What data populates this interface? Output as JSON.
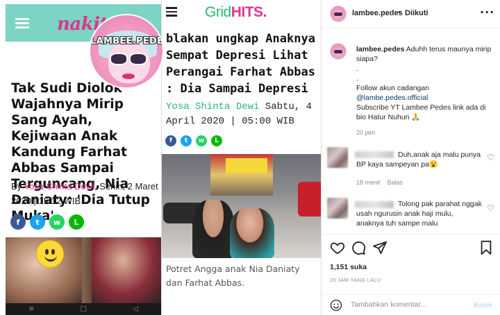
{
  "left_article": {
    "site_logo": "nakita",
    "headline": "Tak Sudi Diolok Wajahnya Mirip Sang Ayah, Kejiwaan Anak Kandung Farhat Abbas Sampai Terguncang, Nia Daniaty: 'Dia Tutup Muka'",
    "byline_prefix": "By ",
    "author": "Yosa Shinta Dewi",
    "date": ", Senin, 2 Maret 2020 | 15:12 WIB",
    "share_icons": [
      "facebook-icon",
      "twitter-icon",
      "whatsapp-icon",
      "line-icon"
    ],
    "android_nav": [
      "≡",
      "□",
      "◁"
    ]
  },
  "watermark": {
    "text": "LAMBEE.PEDES"
  },
  "middle_article": {
    "logo_part1": "Grid",
    "logo_part2": "HITS",
    "headline": "blakan ungkap Anaknya Sempat Depresi Lihat Perangai Farhat Abbas : Dia Sampai Depresi",
    "author": "Yosa Shinta Dewi",
    "date": " Sabtu, 4 April 2020 | 05:00 WIB",
    "photo_caption": "Potret Angga anak Nia Daniaty dan Farhat Abbas.",
    "share_icons": [
      "facebook-icon",
      "twitter-icon",
      "whatsapp-icon",
      "line-icon"
    ],
    "colors": {
      "grid_green": "#2bb673",
      "hits_pink": "#e0358c"
    }
  },
  "instagram": {
    "header": {
      "username": "lambee.pedes",
      "dot": "•",
      "follow_status": "Diikuti",
      "more": "···"
    },
    "caption": {
      "username": "lambee.pedes",
      "line1": " Aduhh terus maunya mirip siapa?",
      "dots": ".\n.",
      "follow": "Follow akun cadangan",
      "link": "@lambe.pedes.official",
      "subscribe": "Subscribe YT Lambee Pedes link ada di bio Hatur Nuhun 🙏",
      "time": "20 jam"
    },
    "comments": [
      {
        "text": "Duh,anak aja malu punya BP kaya sampeyan pa😮",
        "meta_time": "18 menit",
        "meta_reply": "Balas"
      },
      {
        "text": "Tolong pak parahat nggak usah ngurusin anak haji mulu, anaknya tuh sampe malu"
      }
    ],
    "likes": "1,151 suka",
    "posted_ago": "20 JAM YANG LALU",
    "comment_input": {
      "placeholder": "Tambahkan komentar...",
      "post_label": "Kirim"
    },
    "colors": {
      "link": "#00376b",
      "muted": "#8e8e8e",
      "post_disabled": "#b2dffc"
    }
  }
}
